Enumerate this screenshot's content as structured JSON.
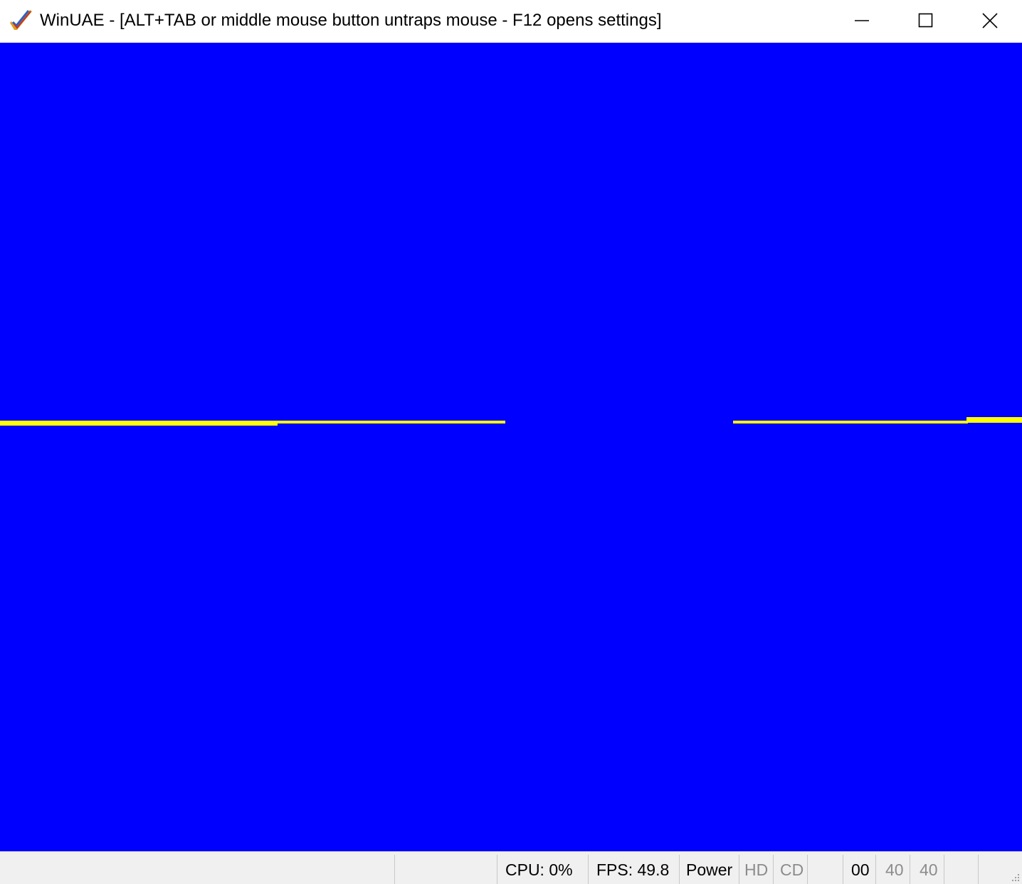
{
  "window": {
    "title": "WinUAE - [ALT+TAB or middle mouse button untraps mouse - F12 opens settings]",
    "app_icon": "winuae-checkmark-icon",
    "controls": {
      "minimize_icon": "minimize-icon",
      "maximize_icon": "maximize-icon",
      "close_icon": "close-icon"
    }
  },
  "display": {
    "background_color": "#0000ff",
    "line_color": "#ffff00"
  },
  "statusbar": {
    "cpu": "CPU: 0%",
    "fps": "FPS: 49.8",
    "power": "Power",
    "hd": "HD",
    "cd": "CD",
    "drive0": "00",
    "drive1": "40",
    "drive2": "40"
  }
}
